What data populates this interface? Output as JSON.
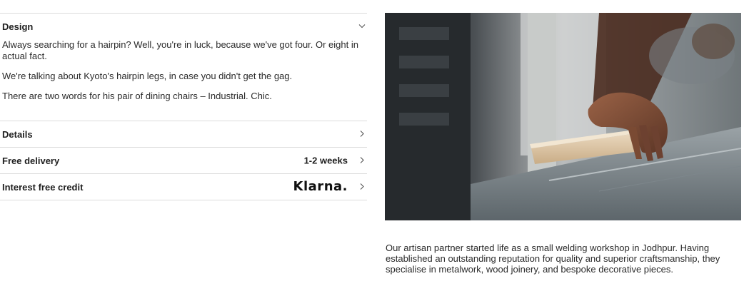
{
  "accordion": {
    "design": {
      "title": "Design",
      "paragraphs": [
        "Always searching for a hairpin? Well, you're in luck, because we've got four. Or eight in actual fact.",
        "We're talking about Kyoto's hairpin legs, in case you didn't get the gag.",
        "There are two words for his pair of dining chairs – Industrial. Chic."
      ]
    },
    "details": {
      "title": "Details"
    },
    "delivery": {
      "title": "Free delivery",
      "value": "1-2 weeks"
    },
    "credit": {
      "title": "Interest free credit",
      "logo_text": "Klarna."
    }
  },
  "icons": {
    "design_toggle": "chevron-down-icon",
    "row_toggle": "chevron-right-icon"
  },
  "caption": {
    "text": "Our artisan partner started life as a small welding workshop in Jodhpur. Having established an outstanding reputation for quality and superior craftsmanship, they specialise in metalwork, wood joinery, and bespoke decorative pieces."
  }
}
